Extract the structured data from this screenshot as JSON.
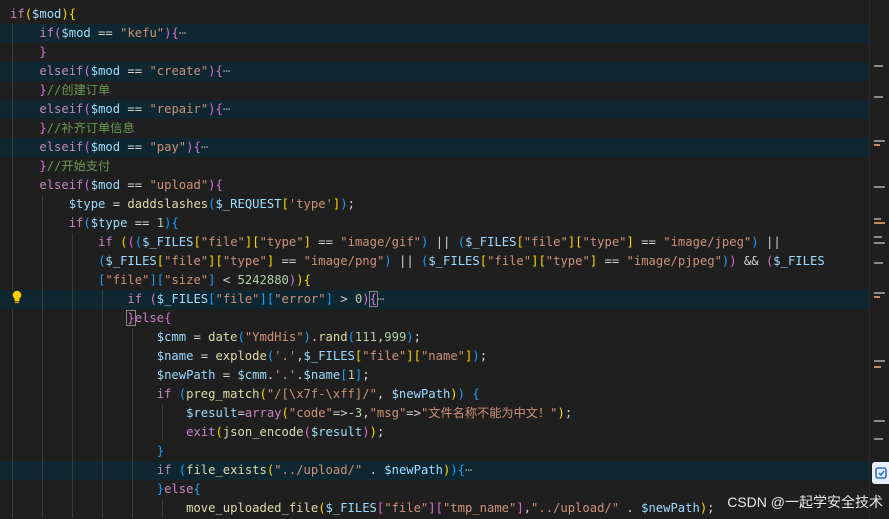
{
  "code_lines": [
    "if($mod){",
    "if($mod == \"kefu\"){",
    "}",
    "elseif($mod == \"create\"){",
    "}//创建订单",
    "elseif($mod == \"repair\"){",
    "}//补齐订单信息",
    "elseif($mod == \"pay\"){",
    "}//开始支付",
    "elseif($mod == \"upload\"){",
    "$type = daddslashes($_REQUEST['type']);",
    "if($type == 1){",
    "if ((($_FILES[\"file\"][\"type\"] == \"image/gif\") || ($_FILES[\"file\"][\"type\"] == \"image/jpeg\") ||",
    "($_FILES[\"file\"][\"type\"] == \"image/png\") || ($_FILES[\"file\"][\"type\"] == \"image/pjpeg\")) && ($_FILES",
    "[\"file\"][\"size\"] < 5242880)){",
    "if ($_FILES[\"file\"][\"error\"] > 0){",
    "}else{",
    "$cmm = date(\"YmdHis\").rand(111,999);",
    "$name = explode('.',$_FILES[\"file\"][\"name\"]);",
    "$newPath = $cmm.'.'.$name[1];",
    "if (preg_match(\"/[\\x7f-\\xff]/\", $newPath)) {",
    "$result=array(\"code\"=>-3,\"msg\"=>\"文件名称不能为中文！\");",
    "exit(json_encode($result));",
    "}",
    "if (file_exists(\"../upload/\" . $newPath)){",
    "}else{",
    "move_uploaded_file($_FILES[\"file\"][\"tmp_name\"],\"../upload/\" . $newPath);"
  ],
  "fold_ellipsis": "⋯",
  "watermark": "CSDN @一起学安全技术",
  "icons": {
    "lightbulb": "lightbulb-icon",
    "side": "side-panel-icon"
  },
  "colors": {
    "background": "#1f1f1f",
    "keyword": "#c586c0",
    "variable": "#9cdcfe",
    "string": "#ce9178",
    "function": "#dcdcaa",
    "comment": "#6a9955",
    "highlight": "#0e2730"
  }
}
